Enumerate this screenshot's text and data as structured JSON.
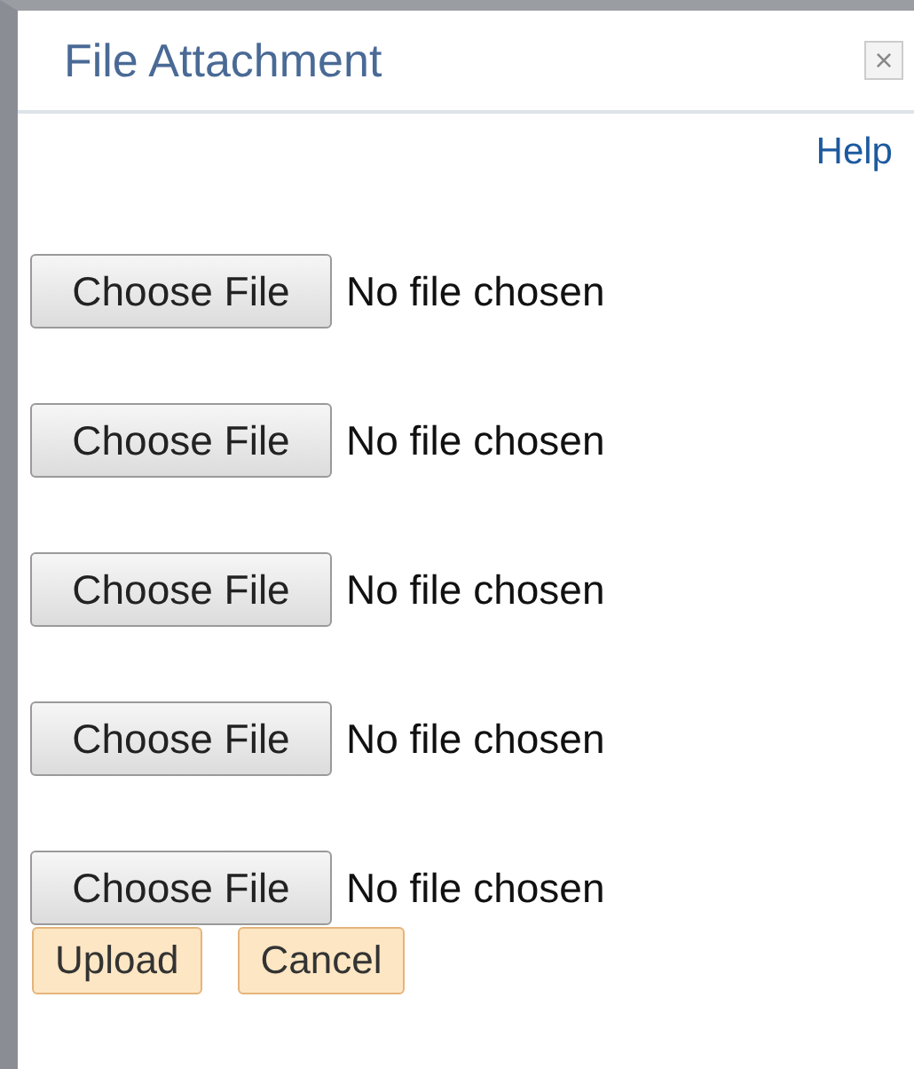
{
  "dialog": {
    "title": "File Attachment",
    "close": "×",
    "help": "Help"
  },
  "files": [
    {
      "button": "Choose File",
      "status": "No file chosen"
    },
    {
      "button": "Choose File",
      "status": "No file chosen"
    },
    {
      "button": "Choose File",
      "status": "No file chosen"
    },
    {
      "button": "Choose File",
      "status": "No file chosen"
    },
    {
      "button": "Choose File",
      "status": "No file chosen"
    }
  ],
  "buttons": [
    "Upload",
    "Cancel"
  ]
}
